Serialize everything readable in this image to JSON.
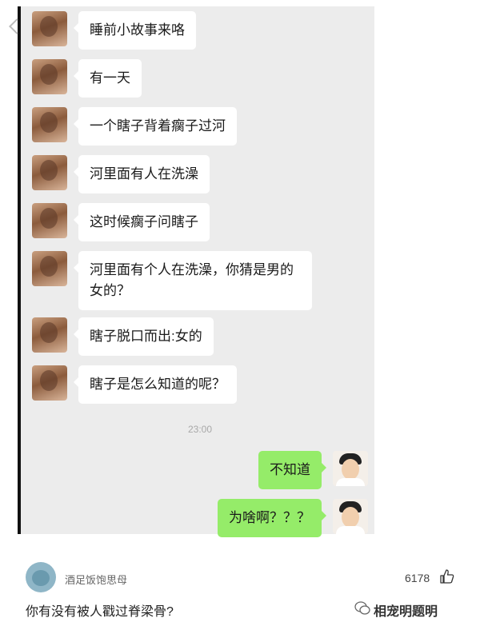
{
  "chat": {
    "left_messages": [
      "睡前小故事来咯",
      "有一天",
      "一个瞎子背着瘸子过河",
      "河里面有人在洗澡",
      "这时候瘸子问瞎子",
      "河里面有个人在洗澡，你猜是男的女的？",
      "瞎子脱口而出:女的",
      "瞎子是怎么知道的呢？"
    ],
    "timestamp": "23:00",
    "right_messages": [
      "不知道",
      "为啥啊？？？"
    ]
  },
  "comment": {
    "username": "酒足饭饱思母",
    "likes": "6178",
    "text": "你有没有被人戳过脊梁骨?"
  },
  "watermark": "相宠明题明"
}
